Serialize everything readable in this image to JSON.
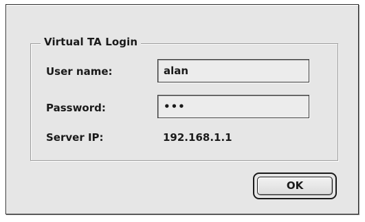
{
  "dialog": {
    "group_title": "Virtual TA Login",
    "username_label": "User name:",
    "username_value": "alan",
    "password_label": "Password:",
    "password_value": "•••",
    "server_label": "Server IP:",
    "server_value": "192.168.1.1",
    "ok_label": "OK"
  }
}
